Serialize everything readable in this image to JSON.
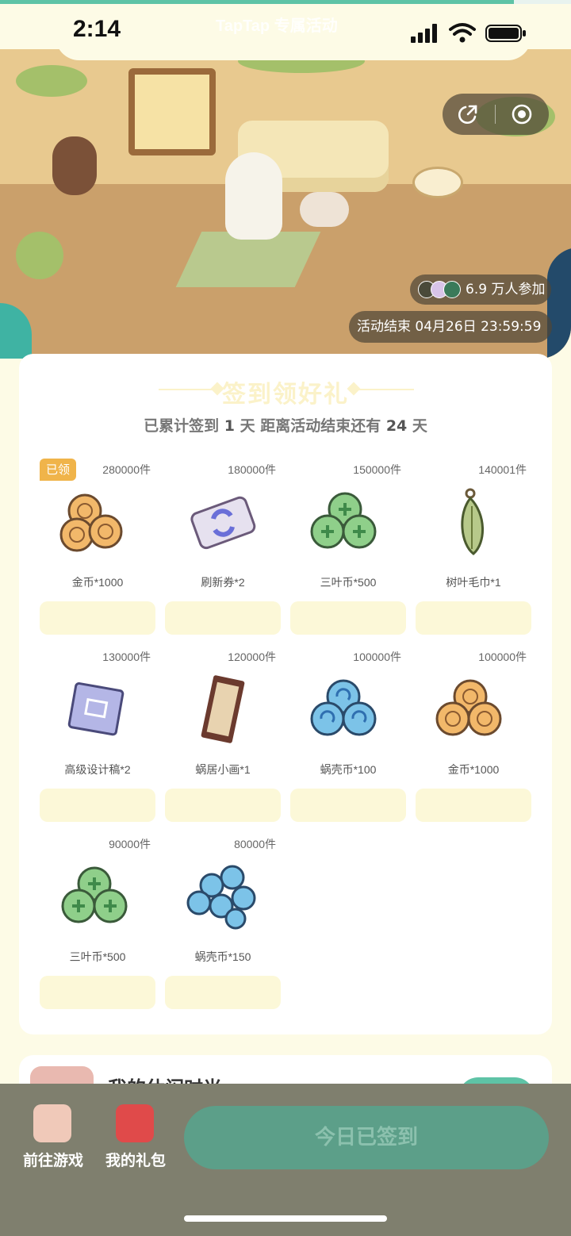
{
  "status": {
    "time": "2:14",
    "watermark": "TapTap 专属活动"
  },
  "load_progress": 0.9,
  "hero": {
    "participants": "6.9 万人参加",
    "deadline": "活动结束 04月26日 23:59:59",
    "icons": [
      "share-icon",
      "record-icon"
    ]
  },
  "signin": {
    "title": "签到领好礼",
    "summary_prefix": "已累计签到",
    "days_signed": "1",
    "summary_mid": "天 距离活动结束还有",
    "days_left": "24",
    "summary_suffix": "天",
    "claimed_label": "已领",
    "items": [
      {
        "count": "280000件",
        "name": "金币*1000",
        "icon": "coin-stack-icon"
      },
      {
        "count": "180000件",
        "name": "刷新券*2",
        "icon": "refresh-ticket-icon"
      },
      {
        "count": "150000件",
        "name": "三叶币*500",
        "icon": "clover-coin-icon"
      },
      {
        "count": "140001件",
        "name": "树叶毛巾*1",
        "icon": "leaf-towel-icon"
      },
      {
        "count": "130000件",
        "name": "高级设计稿*2",
        "icon": "blueprint-icon"
      },
      {
        "count": "120000件",
        "name": "蜗居小画*1",
        "icon": "picture-frame-icon"
      },
      {
        "count": "100000件",
        "name": "蜗壳币*100",
        "icon": "shell-coin-icon"
      },
      {
        "count": "100000件",
        "name": "金币*1000",
        "icon": "coin-stack-icon"
      },
      {
        "count": "90000件",
        "name": "三叶币*500",
        "icon": "clover-coin-icon"
      },
      {
        "count": "80000件",
        "name": "蜗壳币*150",
        "icon": "shell-coin-icon"
      }
    ]
  },
  "my_time": {
    "title": "我的休闲时光"
  },
  "bottom": {
    "go_game": "前往游戏",
    "my_gifts": "我的礼包",
    "checkin": "今日已签到"
  },
  "colors": {
    "accent": "#5ec3a6",
    "badge": "#f0b44a",
    "bottom_bar": "#7f7f6e"
  }
}
